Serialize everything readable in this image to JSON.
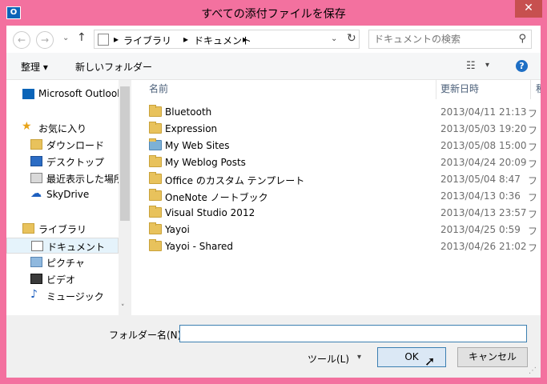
{
  "window": {
    "title": "すべての添付ファイルを保存",
    "close_glyph": "✕",
    "app_icon_text": "O"
  },
  "address": {
    "back_glyph": "←",
    "forward_glyph": "→",
    "dropdown_glyph": "⌄",
    "up_glyph": "↑",
    "crumbs": [
      "ライブラリ",
      "ドキュメント"
    ],
    "separator": "▸",
    "refresh_glyph": "↻",
    "search_placeholder": "ドキュメントの検索",
    "search_glyph": "⚲"
  },
  "toolbar": {
    "organize": "整理 ▾",
    "new_folder": "新しいフォルダー",
    "view_glyph": "☷",
    "view_drop_glyph": "▾",
    "help_glyph": "?"
  },
  "nav": {
    "items": [
      {
        "label": "Microsoft Outlook",
        "icon": "outlook-icon"
      },
      {
        "label": "お気に入り",
        "icon": "star-icon"
      },
      {
        "label": "ダウンロード",
        "icon": "download-folder-icon"
      },
      {
        "label": "デスクトップ",
        "icon": "desktop-icon"
      },
      {
        "label": "最近表示した場所",
        "icon": "recent-places-icon"
      },
      {
        "label": "SkyDrive",
        "icon": "skydrive-icon"
      },
      {
        "label": "ライブラリ",
        "icon": "libraries-icon"
      },
      {
        "label": "ドキュメント",
        "icon": "documents-icon"
      },
      {
        "label": "ピクチャ",
        "icon": "pictures-icon"
      },
      {
        "label": "ビデオ",
        "icon": "videos-icon"
      },
      {
        "label": "ミュージック",
        "icon": "music-icon"
      }
    ],
    "scroll_up_glyph": "˄",
    "scroll_down_glyph": "˅"
  },
  "files": {
    "columns": {
      "name": "名前",
      "date": "更新日時",
      "kind": "種"
    },
    "sort_caret": "˄",
    "rows": [
      {
        "name": "Bluetooth",
        "date": "2013/04/11 21:13",
        "kind": "フ"
      },
      {
        "name": "Expression",
        "date": "2013/05/03 19:20",
        "kind": "フ"
      },
      {
        "name": "My Web Sites",
        "date": "2013/05/08 15:00",
        "kind": "フ"
      },
      {
        "name": "My Weblog Posts",
        "date": "2013/04/24 20:09",
        "kind": "フ"
      },
      {
        "name": "Office のカスタム テンプレート",
        "date": "2013/05/04 8:47",
        "kind": "フ"
      },
      {
        "name": "OneNote ノートブック",
        "date": "2013/04/13 0:36",
        "kind": "フ"
      },
      {
        "name": "Visual Studio 2012",
        "date": "2013/04/13 23:57",
        "kind": "フ"
      },
      {
        "name": "Yayoi",
        "date": "2013/04/25 0:59",
        "kind": "フ"
      },
      {
        "name": "Yayoi - Shared",
        "date": "2013/04/26 21:02",
        "kind": "フ"
      }
    ],
    "h_left_glyph": "<",
    "h_right_glyph": ">"
  },
  "footer": {
    "folder_label": "フォルダー名(N):",
    "folder_value": "",
    "tools_label": "ツール(L)",
    "tools_drop_glyph": "▾",
    "ok_label": "OK",
    "cancel_label": "キャンセル"
  },
  "colors": {
    "frame": "#f3719f",
    "close": "#c7504f",
    "selection": "#e5f3fb",
    "accent": "#3c7fb1"
  }
}
